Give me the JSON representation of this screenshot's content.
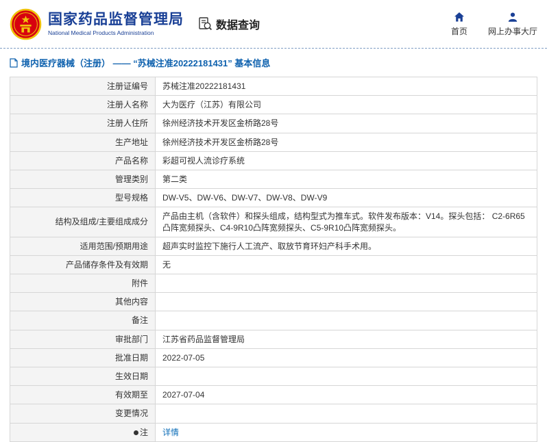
{
  "colors": {
    "brand_blue": "#1a4096",
    "link_blue": "#0e61ae",
    "emblem_red": "#d7000f",
    "emblem_gold": "#f0c20c"
  },
  "header": {
    "org_name_cn": "国家药品监督管理局",
    "org_name_en": "National Medical Products Administration",
    "section_title": "数据查询",
    "nav": [
      {
        "label": "首页",
        "icon": "home-icon"
      },
      {
        "label": "网上办事大厅",
        "icon": "user-icon"
      }
    ]
  },
  "breadcrumb": "境内医疗器械（注册） —— “苏械注准20222181431” 基本信息",
  "table": {
    "rows": [
      {
        "label": "注册证编号",
        "value": "苏械注准20222181431"
      },
      {
        "label": "注册人名称",
        "value": "大为医疗（江苏）有限公司"
      },
      {
        "label": "注册人住所",
        "value": "徐州经济技术开发区金桥路28号"
      },
      {
        "label": "生产地址",
        "value": "徐州经济技术开发区金桥路28号"
      },
      {
        "label": "产品名称",
        "value": "彩超可视人流诊疗系统"
      },
      {
        "label": "管理类别",
        "value": "第二类"
      },
      {
        "label": "型号规格",
        "value": "DW-V5、DW-V6、DW-V7、DW-V8、DW-V9"
      },
      {
        "label": "结构及组成/主要组成成分",
        "value": "产品由主机（含软件）和探头组成，结构型式为推车式。软件发布版本：V14。探头包括： C2-6R65凸阵宽频探头、C4-9R10凸阵宽频探头、C5-9R10凸阵宽频探头。"
      },
      {
        "label": "适用范围/预期用途",
        "value": "超声实时监控下施行人工流产、取放节育环妇产科手术用。"
      },
      {
        "label": "产品储存条件及有效期",
        "value": "无"
      },
      {
        "label": "附件",
        "value": ""
      },
      {
        "label": "其他内容",
        "value": ""
      },
      {
        "label": "备注",
        "value": ""
      },
      {
        "label": "审批部门",
        "value": "江苏省药品监督管理局"
      },
      {
        "label": "批准日期",
        "value": "2022-07-05"
      },
      {
        "label": "生效日期",
        "value": ""
      },
      {
        "label": "有效期至",
        "value": "2027-07-04"
      },
      {
        "label": "变更情况",
        "value": ""
      },
      {
        "label": "注",
        "value": "详情"
      }
    ]
  }
}
